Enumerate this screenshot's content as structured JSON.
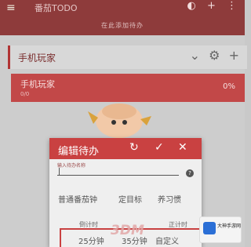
{
  "topbar": {
    "title": "番茄TODO",
    "subtitle": "在此添加待办",
    "icons": [
      "menu-icon",
      "theme-icon",
      "add-icon",
      "more-icon"
    ]
  },
  "list": {
    "header_name": "手机玩家",
    "item": {
      "name": "手机玩家",
      "sub": "0/0",
      "percent": "0%"
    }
  },
  "dialog": {
    "title": "编辑待办",
    "input_label": "输入待办名称",
    "input_value": "",
    "help_mark": "?",
    "options": [
      "普通番茄钟",
      "定目标",
      "养习惯"
    ],
    "timing_labels": [
      "倒计时",
      "正计时"
    ],
    "durations": [
      "25分钟",
      "35分钟",
      "自定义"
    ]
  },
  "watermark": "3DM",
  "badge": {
    "line1": "大神手游网"
  },
  "colors": {
    "accent": "#c94141",
    "bar": "#8e3b3b"
  }
}
